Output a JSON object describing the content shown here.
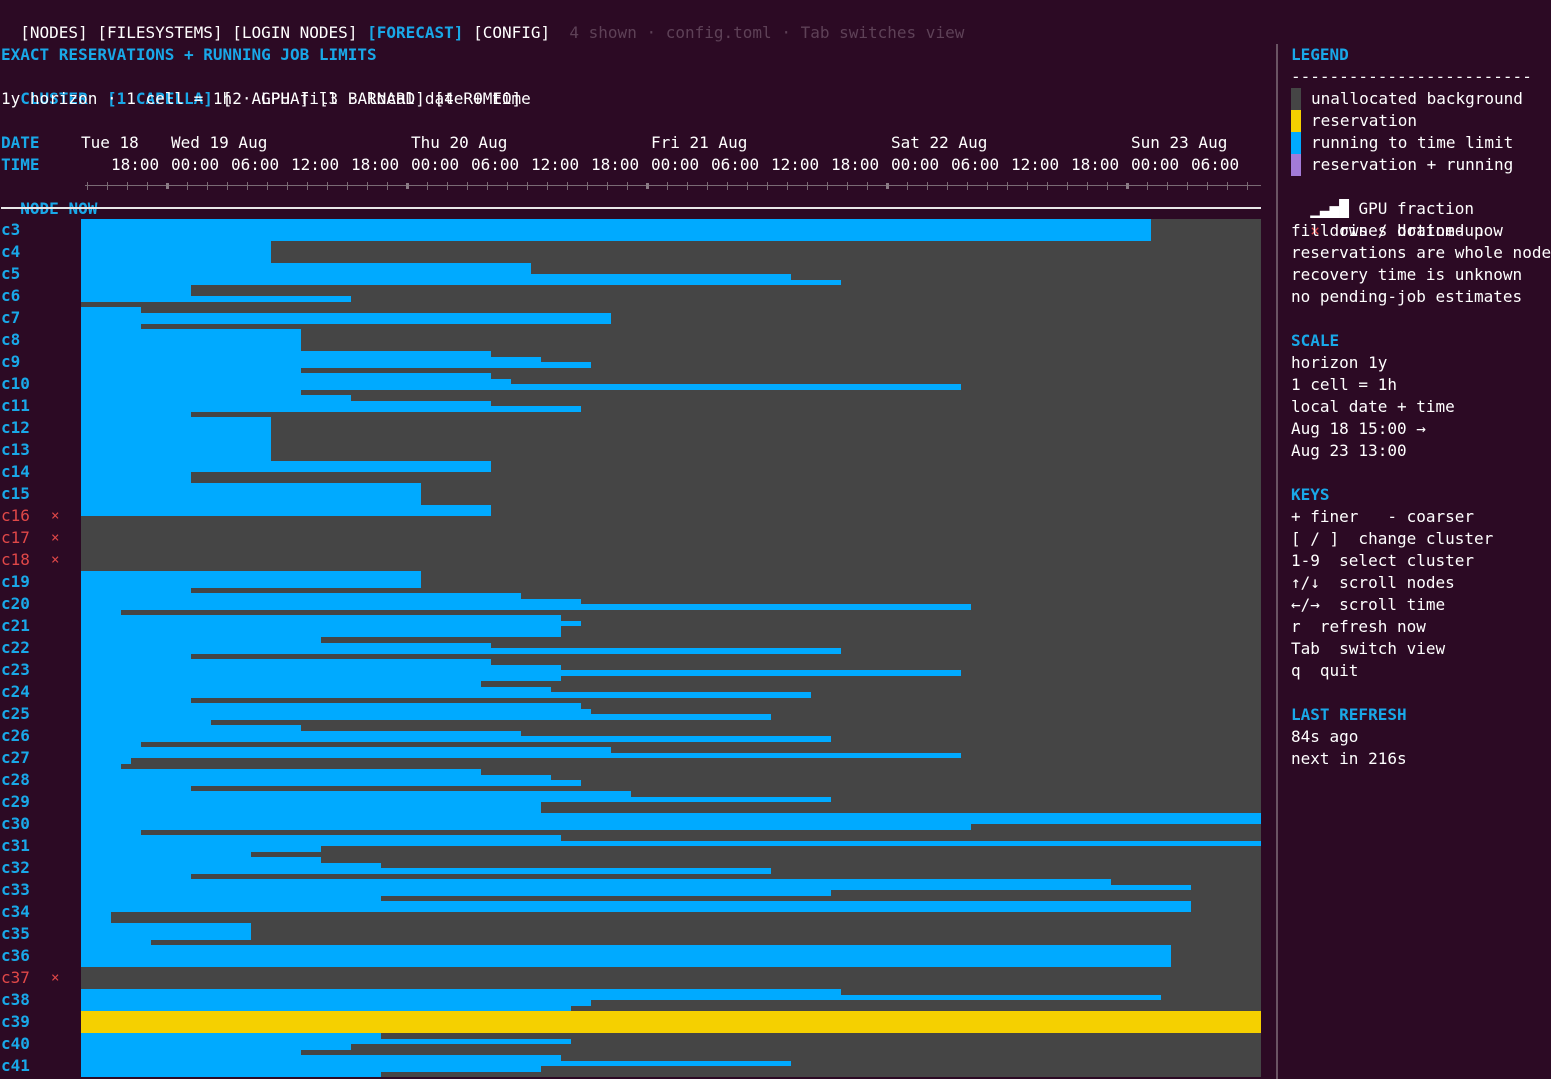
{
  "tabs": [
    {
      "label": "[NODES]",
      "active": false
    },
    {
      "label": "[FILESYSTEMS]",
      "active": false
    },
    {
      "label": "[LOGIN NODES]",
      "active": false
    },
    {
      "label": "[FORECAST]",
      "active": true
    },
    {
      "label": "[CONFIG]",
      "active": false
    }
  ],
  "status_hint": "4 shown · config.toml · Tab switches view",
  "forecast": {
    "title": "EXACT RESERVATIONS + RUNNING JOB LIMITS",
    "cluster_label": "CLUSTER",
    "clusters": [
      {
        "label": "[1 CAPELLA]",
        "active": true
      },
      {
        "label": "[2 ALPHA]",
        "active": false
      },
      {
        "label": "[3 BARNARD]",
        "active": false
      },
      {
        "label": "[4 ROMEO]",
        "active": false
      }
    ],
    "info": "1y horizon · 1 cell = 1h · GPU fill · local date + time",
    "header": {
      "date_label": "DATE",
      "time_label": "TIME",
      "node_label": "NODE",
      "now_label": "NOW",
      "dates": [
        "Tue 18",
        "Wed 19 Aug",
        "Thu 20 Aug",
        "Fri 21 Aug",
        "Sat 22 Aug",
        "Sun 23 Aug"
      ],
      "times": [
        "18:00",
        "00:00",
        "06:00",
        "12:00",
        "18:00",
        "00:00",
        "06:00",
        "12:00",
        "18:00",
        "00:00",
        "06:00",
        "12:00",
        "18:00",
        "00:00",
        "06:00",
        "12:00",
        "18:00",
        "00:00",
        "06:00"
      ]
    }
  },
  "nodes": [
    {
      "name": "c3",
      "down": false,
      "status": "",
      "reservation": false,
      "hours": [
        107,
        107,
        107,
        107
      ]
    },
    {
      "name": "c4",
      "down": false,
      "status": "",
      "reservation": false,
      "hours": [
        19,
        19,
        19,
        19
      ]
    },
    {
      "name": "c5",
      "down": false,
      "status": "",
      "reservation": false,
      "hours": [
        45,
        45,
        71,
        76
      ]
    },
    {
      "name": "c6",
      "down": false,
      "status": "",
      "reservation": false,
      "hours": [
        11,
        11,
        27,
        0
      ]
    },
    {
      "name": "c7",
      "down": false,
      "status": "",
      "reservation": false,
      "hours": [
        6,
        53,
        53,
        6
      ]
    },
    {
      "name": "c8",
      "down": false,
      "status": "",
      "reservation": false,
      "hours": [
        22,
        22,
        22,
        22
      ]
    },
    {
      "name": "c9",
      "down": false,
      "status": "",
      "reservation": false,
      "hours": [
        41,
        46,
        51,
        22
      ]
    },
    {
      "name": "c10",
      "down": false,
      "status": "",
      "reservation": false,
      "hours": [
        41,
        43,
        88,
        22
      ]
    },
    {
      "name": "c11",
      "down": false,
      "status": "",
      "reservation": false,
      "hours": [
        27,
        41,
        50,
        11
      ]
    },
    {
      "name": "c12",
      "down": false,
      "status": "",
      "reservation": false,
      "hours": [
        19,
        19,
        19,
        19
      ]
    },
    {
      "name": "c13",
      "down": false,
      "status": "",
      "reservation": false,
      "hours": [
        19,
        19,
        19,
        19
      ]
    },
    {
      "name": "c14",
      "down": false,
      "status": "",
      "reservation": false,
      "hours": [
        41,
        41,
        11,
        11
      ]
    },
    {
      "name": "c15",
      "down": false,
      "status": "",
      "reservation": false,
      "hours": [
        34,
        34,
        34,
        34
      ]
    },
    {
      "name": "c16",
      "down": true,
      "status": "×",
      "reservation": false,
      "hours": [
        41,
        41,
        0,
        0
      ]
    },
    {
      "name": "c17",
      "down": true,
      "status": "×",
      "reservation": false,
      "hours": [
        0,
        0,
        0,
        0
      ]
    },
    {
      "name": "c18",
      "down": true,
      "status": "×",
      "reservation": false,
      "hours": [
        0,
        0,
        0,
        0
      ]
    },
    {
      "name": "c19",
      "down": false,
      "status": "",
      "reservation": false,
      "hours": [
        34,
        34,
        34,
        11
      ]
    },
    {
      "name": "c20",
      "down": false,
      "status": "",
      "reservation": false,
      "hours": [
        44,
        50,
        89,
        4
      ]
    },
    {
      "name": "c21",
      "down": false,
      "status": "",
      "reservation": false,
      "hours": [
        48,
        50,
        48,
        48
      ]
    },
    {
      "name": "c22",
      "down": false,
      "status": "",
      "reservation": false,
      "hours": [
        24,
        41,
        76,
        11
      ]
    },
    {
      "name": "c23",
      "down": false,
      "status": "",
      "reservation": false,
      "hours": [
        41,
        48,
        88,
        48
      ]
    },
    {
      "name": "c24",
      "down": false,
      "status": "",
      "reservation": false,
      "hours": [
        40,
        47,
        73,
        11
      ]
    },
    {
      "name": "c25",
      "down": false,
      "status": "",
      "reservation": false,
      "hours": [
        50,
        51,
        69,
        13
      ]
    },
    {
      "name": "c26",
      "down": false,
      "status": "",
      "reservation": false,
      "hours": [
        22,
        44,
        75,
        6
      ]
    },
    {
      "name": "c27",
      "down": false,
      "status": "",
      "reservation": false,
      "hours": [
        53,
        88,
        5,
        4
      ]
    },
    {
      "name": "c28",
      "down": false,
      "status": "",
      "reservation": false,
      "hours": [
        40,
        47,
        50,
        11
      ]
    },
    {
      "name": "c29",
      "down": false,
      "status": "",
      "reservation": false,
      "hours": [
        55,
        75,
        46,
        46
      ]
    },
    {
      "name": "c30",
      "down": false,
      "status": "",
      "reservation": false,
      "hours": [
        118,
        118,
        89,
        6
      ]
    },
    {
      "name": "c31",
      "down": false,
      "status": "",
      "reservation": false,
      "hours": [
        48,
        118,
        24,
        17
      ]
    },
    {
      "name": "c32",
      "down": false,
      "status": "",
      "reservation": false,
      "hours": [
        24,
        30,
        69,
        11
      ]
    },
    {
      "name": "c33",
      "down": false,
      "status": "",
      "reservation": false,
      "hours": [
        103,
        111,
        75,
        30
      ]
    },
    {
      "name": "c34",
      "down": false,
      "status": "",
      "reservation": false,
      "hours": [
        111,
        111,
        3,
        3
      ]
    },
    {
      "name": "c35",
      "down": false,
      "status": "",
      "reservation": false,
      "hours": [
        17,
        17,
        17,
        7
      ]
    },
    {
      "name": "c36",
      "down": false,
      "status": "",
      "reservation": false,
      "hours": [
        109,
        109,
        109,
        109
      ]
    },
    {
      "name": "c37",
      "down": true,
      "status": "×",
      "reservation": false,
      "hours": [
        0,
        0,
        0,
        0
      ]
    },
    {
      "name": "c38",
      "down": false,
      "status": "",
      "reservation": false,
      "hours": [
        76,
        108,
        51,
        49
      ]
    },
    {
      "name": "c39",
      "down": false,
      "status": "",
      "reservation": true,
      "hours": [
        118,
        118,
        118,
        118
      ]
    },
    {
      "name": "c40",
      "down": false,
      "status": "",
      "reservation": false,
      "hours": [
        30,
        49,
        27,
        22
      ]
    },
    {
      "name": "c41",
      "down": false,
      "status": "",
      "reservation": false,
      "hours": [
        48,
        71,
        46,
        30
      ]
    }
  ],
  "legend": {
    "title": "LEGEND",
    "rule": "-------------------------",
    "items": [
      {
        "label": "unallocated background",
        "color": "#454545"
      },
      {
        "label": "reservation",
        "color": "#f5d000"
      },
      {
        "label": "running to time limit",
        "color": "#00aaff"
      },
      {
        "label": "reservation + running",
        "color": "#a37bd8"
      }
    ],
    "gpu_glyph": "▁▃▅█",
    "gpu_label": "GPU fraction",
    "down_glyph": "×",
    "down_label": "down / drained now",
    "notes": [
      "fill rises bottom-up",
      "reservations are whole nodes",
      "recovery time is unknown",
      "no pending-job estimates"
    ]
  },
  "scale": {
    "title": "SCALE",
    "lines": [
      "horizon 1y",
      "1 cell = 1h",
      "local date + time",
      "Aug 18 15:00 →",
      "Aug 23 13:00"
    ]
  },
  "keys": {
    "title": "KEYS",
    "lines": [
      "+ finer   - coarser",
      "[ / ]  change cluster",
      "1-9  select cluster",
      "↑/↓  scroll nodes",
      "←/→  scroll time",
      "r  refresh now",
      "Tab  switch view",
      "q  quit"
    ]
  },
  "refresh": {
    "title": "LAST REFRESH",
    "ago": "84s ago",
    "next": "next in 216s"
  },
  "colors": {
    "background": "#2c0a24",
    "accent": "#19a8e8",
    "running": "#00aaff",
    "reservation": "#f5d000",
    "unallocated": "#454545",
    "down": "#e04848"
  }
}
